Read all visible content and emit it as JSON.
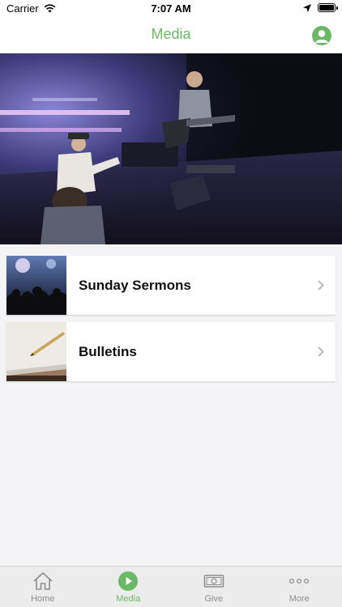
{
  "status": {
    "carrier": "Carrier",
    "time": "7:07 AM"
  },
  "header": {
    "title": "Media",
    "profile_icon": "profile-icon"
  },
  "colors": {
    "accent": "#6db866",
    "background": "#f4f4f6",
    "tabbar": "#ececec"
  },
  "media_items": [
    {
      "label": "Sunday Sermons",
      "thumb_icon": "concert-crowd-thumbnail"
    },
    {
      "label": "Bulletins",
      "thumb_icon": "notebook-pencil-thumbnail"
    }
  ],
  "tabs": [
    {
      "label": "Home",
      "icon": "home-icon",
      "active": false
    },
    {
      "label": "Media",
      "icon": "play-icon",
      "active": true
    },
    {
      "label": "Give",
      "icon": "money-icon",
      "active": false
    },
    {
      "label": "More",
      "icon": "more-icon",
      "active": false
    }
  ]
}
